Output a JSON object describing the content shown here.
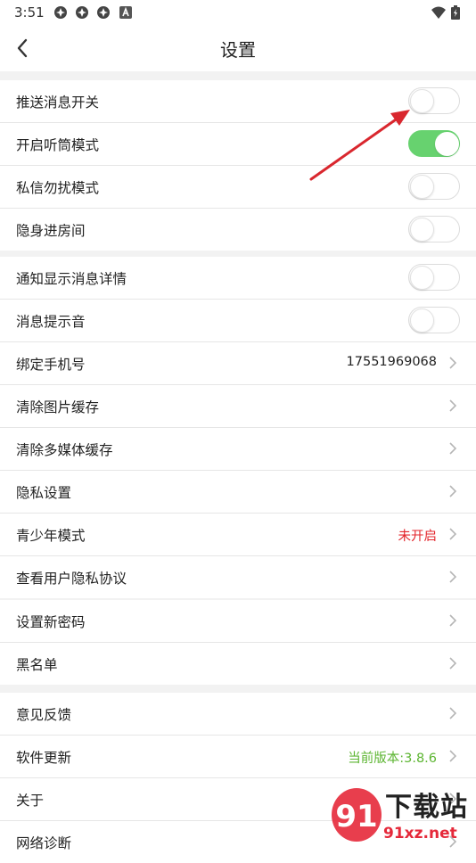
{
  "status_bar": {
    "time": "3:51",
    "icons": [
      "notification-icon",
      "notification-icon",
      "notification-icon",
      "app-a-icon",
      "wifi-icon",
      "battery-icon"
    ]
  },
  "app_bar": {
    "title": "设置"
  },
  "groups": [
    {
      "rows": [
        {
          "label": "推送消息开关",
          "type": "toggle",
          "on": false
        },
        {
          "label": "开启听筒模式",
          "type": "toggle",
          "on": true
        },
        {
          "label": "私信勿扰模式",
          "type": "toggle",
          "on": false
        },
        {
          "label": "隐身进房间",
          "type": "toggle",
          "on": false
        }
      ]
    },
    {
      "rows": [
        {
          "label": "通知显示消息详情",
          "type": "toggle",
          "on": false
        },
        {
          "label": "消息提示音",
          "type": "toggle",
          "on": false
        },
        {
          "label": "绑定手机号",
          "type": "link",
          "value": "17551969068"
        },
        {
          "label": "清除图片缓存",
          "type": "link"
        },
        {
          "label": "清除多媒体缓存",
          "type": "link"
        },
        {
          "label": "隐私设置",
          "type": "link"
        },
        {
          "label": "青少年模式",
          "type": "link",
          "value": "未开启",
          "value_color": "#e3262c"
        },
        {
          "label": "查看用户隐私协议",
          "type": "link"
        }
      ]
    },
    {
      "rows": [
        {
          "label": "设置新密码",
          "type": "link"
        },
        {
          "label": "黑名单",
          "type": "link"
        }
      ]
    },
    {
      "rows": [
        {
          "label": "意见反馈",
          "type": "link"
        },
        {
          "label": "软件更新",
          "type": "link",
          "value": "当前版本:3.8.6",
          "value_color": "#5cb531"
        },
        {
          "label": "关于",
          "type": "link"
        },
        {
          "label": "网络诊断",
          "type": "link"
        }
      ]
    }
  ],
  "annotation": {
    "color": "#d9272e",
    "icon": "red-arrow"
  },
  "watermark": {
    "brand": "下载站",
    "domain": "91xz.net",
    "logo": "91-logo"
  },
  "colors": {
    "toggle_on": "#67d26f",
    "chevron": "#b5b5b5"
  }
}
